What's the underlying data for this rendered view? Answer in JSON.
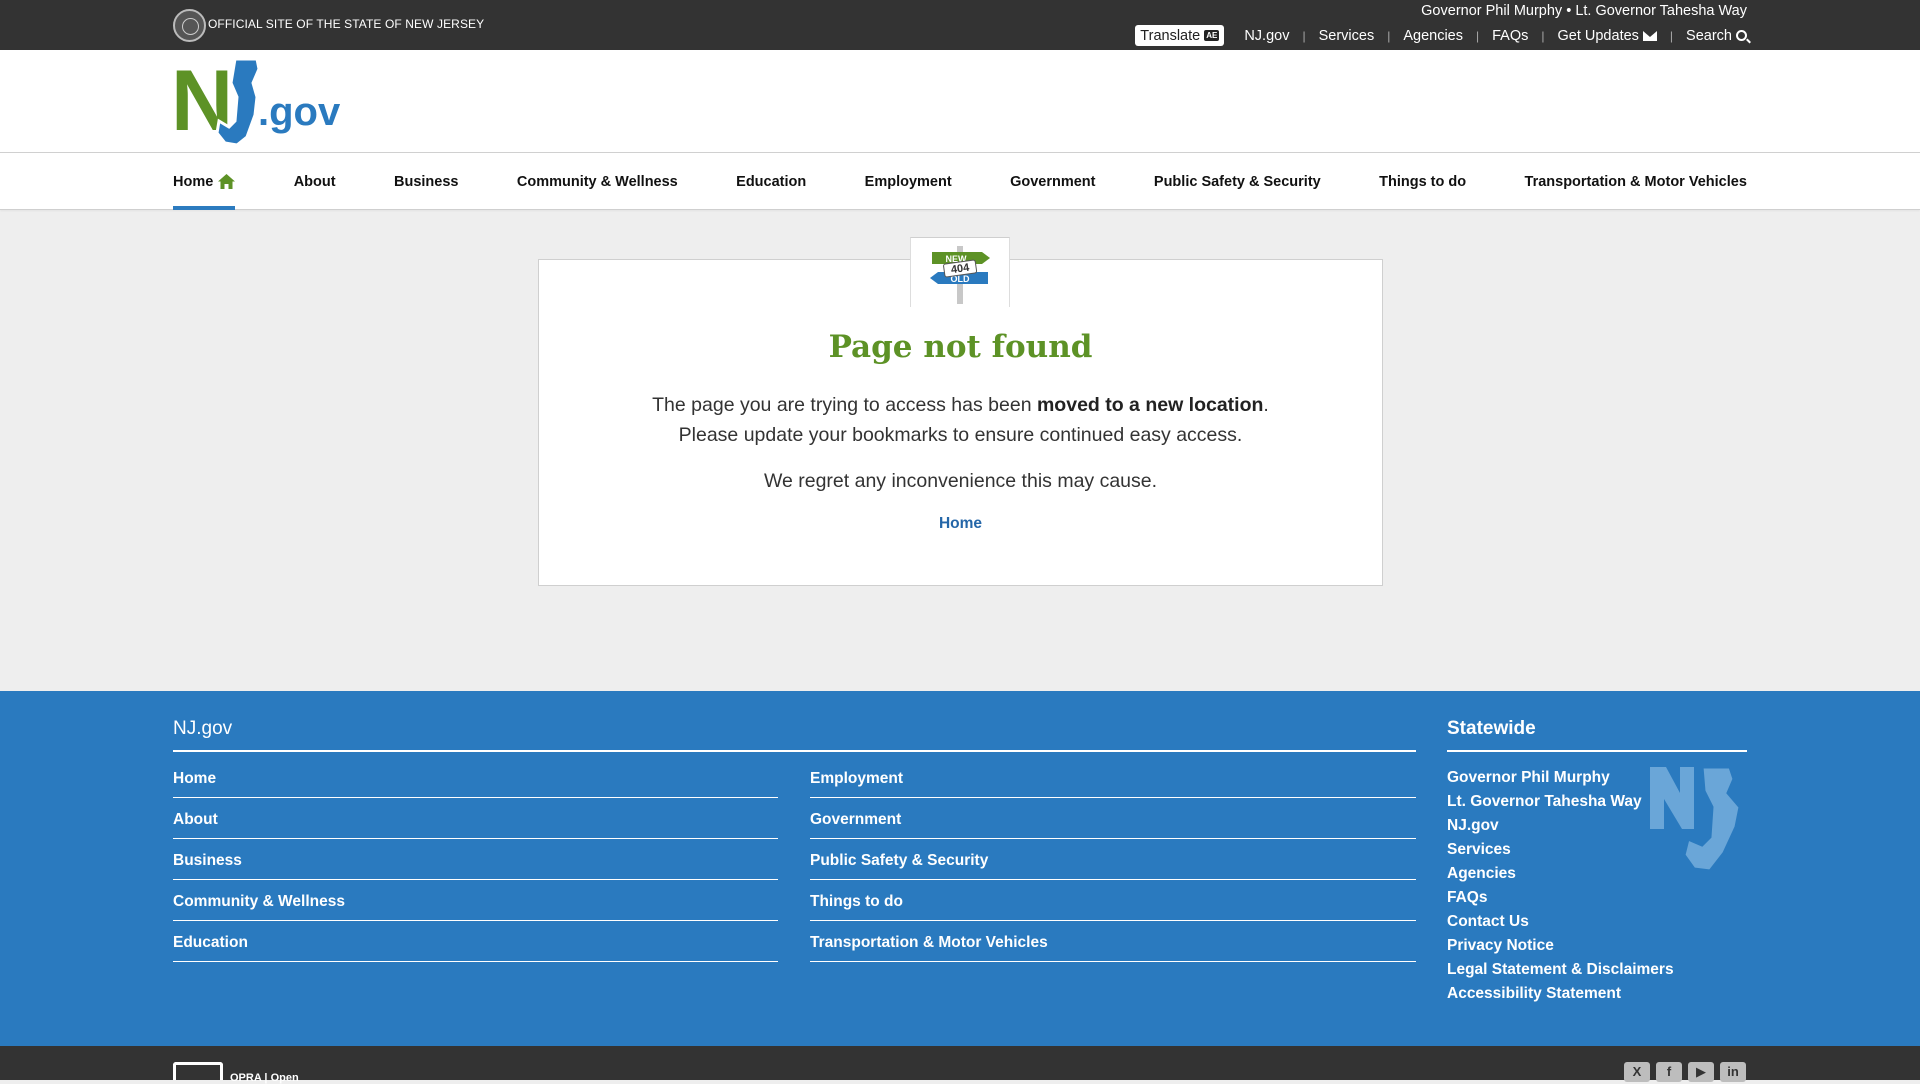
{
  "topbar": {
    "official_text": "Official Site of the State of New Jersey",
    "leaders": "Governor Phil Murphy • Lt. Governor Tahesha Way",
    "translate_label": "Translate",
    "links": [
      "NJ.gov",
      "Services",
      "Agencies",
      "FAQs",
      "Get Updates",
      "Search"
    ]
  },
  "logo": {
    "nj": "NJ",
    "gov": ".gov"
  },
  "mainnav": {
    "items": [
      "Home",
      "About",
      "Business",
      "Community & Wellness",
      "Education",
      "Employment",
      "Government",
      "Public Safety & Security",
      "Things to do",
      "Transportation & Motor Vehicles"
    ],
    "active": "Home"
  },
  "sign": {
    "top": "NEW",
    "middle": "404",
    "bottom": "OLD"
  },
  "error": {
    "title": "Page not found",
    "line1_pre": "The page you are trying to access has been ",
    "line1_bold": "moved to a new location",
    "line1_post": ".",
    "line2": "Please update your bookmarks to ensure continued easy access.",
    "line3": "We regret any inconvenience this may cause.",
    "home_link": "Home"
  },
  "footer": {
    "title_left": "NJ.gov",
    "col1": [
      "Home",
      "About",
      "Business",
      "Community & Wellness",
      "Education"
    ],
    "col2": [
      "Employment",
      "Government",
      "Public Safety & Security",
      "Things to do",
      "Transportation & Motor Vehicles"
    ],
    "title_right": "Statewide",
    "statewide": [
      "Governor Phil Murphy",
      "Lt. Governor Tahesha Way",
      "NJ.gov",
      "Services",
      "Agencies",
      "FAQs",
      "Contact Us",
      "Privacy Notice",
      "Legal Statement & Disclaimers",
      "Accessibility Statement"
    ]
  },
  "bottombar": {
    "opra": "OPRA | Open",
    "social": [
      "X",
      "f",
      "▶",
      "in"
    ]
  },
  "colors": {
    "green": "#5d9226",
    "blue": "#2a7abf",
    "dark": "#333333",
    "link": "#2466a8"
  }
}
